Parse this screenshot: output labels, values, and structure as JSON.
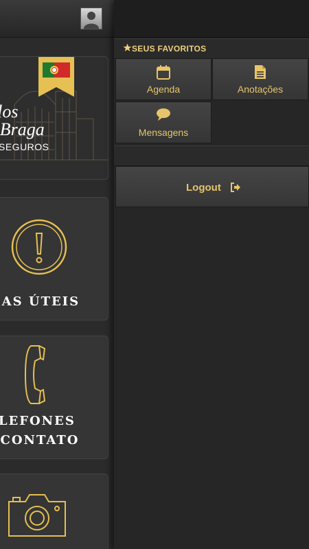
{
  "main": {
    "logo": {
      "script_line1": "arlos",
      "script_line2": "la Braga",
      "subtitle": "U SEGUROS"
    },
    "tiles": [
      {
        "lines": [
          "ICAS ÚTEIS"
        ],
        "icon": "exclamation-circle-icon"
      },
      {
        "lines": [
          "ELEFONES",
          "E CONTATO"
        ],
        "icon": "phone-handset-icon"
      },
      {
        "lines": [],
        "icon": "camera-icon"
      }
    ]
  },
  "drawer": {
    "favorites_header": "SEUS FAVORITOS",
    "favorites": [
      {
        "label": "Agenda",
        "icon": "calendar-icon"
      },
      {
        "label": "Anotações",
        "icon": "document-icon"
      },
      {
        "label": "Mensagens",
        "icon": "chat-bubble-icon"
      }
    ],
    "logout_label": "Logout"
  },
  "colors": {
    "accent": "#e8c56a",
    "background": "#252525",
    "tile": "#353535"
  }
}
